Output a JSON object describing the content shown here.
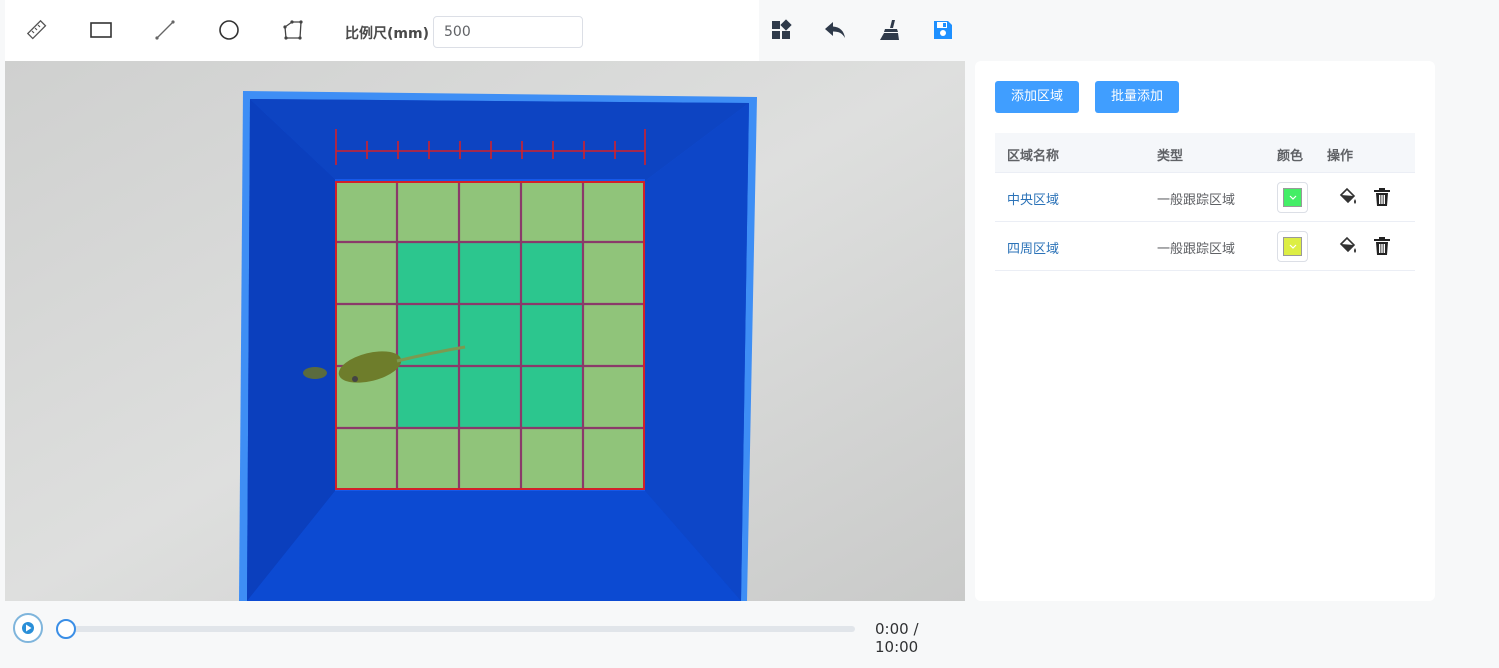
{
  "toolbar": {
    "tools": [
      {
        "name": "ruler-icon"
      },
      {
        "name": "rectangle-icon"
      },
      {
        "name": "line-icon"
      },
      {
        "name": "circle-icon"
      },
      {
        "name": "polygon-icon"
      }
    ],
    "scale_label": "比例尺(mm)",
    "scale_value": "500",
    "actions": [
      {
        "name": "layout-icon"
      },
      {
        "name": "undo-icon"
      },
      {
        "name": "clear-brush-icon"
      },
      {
        "name": "save-icon"
      }
    ]
  },
  "player": {
    "time": "0:00 / 10:00",
    "progress": 0
  },
  "panel": {
    "add_button": "添加区域",
    "batch_button": "批量添加",
    "columns": [
      "区域名称",
      "类型",
      "颜色",
      "操作"
    ],
    "rows": [
      {
        "name": "中央区域",
        "type": "一般跟踪区域",
        "color": "#44ee66"
      },
      {
        "name": "四周区域",
        "type": "一般跟踪区域",
        "color": "#ddee44"
      }
    ]
  },
  "colors": {
    "accent": "#409eff",
    "grid_line": "#d2202a",
    "arena_blue": "#0a5ef0"
  }
}
